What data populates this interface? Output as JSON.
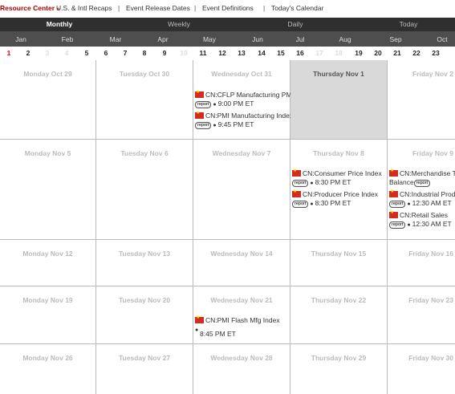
{
  "topnav": {
    "resource_center": "Resource Center",
    "resource_arrow": "»",
    "recaps": "U.S. & Intl Recaps",
    "release_dates": "Event Release Dates",
    "definitions": "Event Definitions",
    "todays": "Today's Calendar",
    "separator": "|"
  },
  "views": [
    "Monthly",
    "Weekly",
    "Daily",
    "Today"
  ],
  "months": [
    "Jan",
    "Feb",
    "Mar",
    "Apr",
    "May",
    "Jun",
    "Jul",
    "Aug",
    "Sep",
    "Oct"
  ],
  "day_numbers": [
    "1",
    "2",
    "3",
    "4",
    "5",
    "6",
    "7",
    "8",
    "9",
    "10",
    "11",
    "12",
    "13",
    "14",
    "15",
    "16",
    "17",
    "18",
    "19",
    "20",
    "21",
    "22",
    "23"
  ],
  "report_label": "report",
  "rows": [
    [
      "Monday Oct 29",
      "Tuesday Oct 30",
      "Wednesday Oct 31",
      "Thursday Nov 1",
      "Friday Nov 2"
    ],
    [
      "Monday Nov 5",
      "Tuesday Nov 6",
      "Wednesday Nov 7",
      "Thursday Nov 8",
      "Friday Nov 9"
    ],
    [
      "Monday Nov 12",
      "Tuesday Nov 13",
      "Wednesday Nov 14",
      "Thursday Nov 15",
      "Friday Nov 16"
    ],
    [
      "Monday Nov 19",
      "Tuesday Nov 20",
      "Wednesday Nov 21",
      "Thursday Nov 22",
      "Friday Nov 23"
    ],
    [
      "Monday Nov 26",
      "Tuesday Nov 27",
      "Wednesday Nov 28",
      "Thursday Nov 29",
      "Friday Nov 30"
    ]
  ],
  "events": {
    "oct31_a": {
      "name": "CN:CFLP Manufacturing PMI",
      "time": "9:00 PM ET"
    },
    "oct31_b": {
      "name": "CN:PMI Manufacturing Index",
      "time": "9:45 PM ET"
    },
    "nov8_a": {
      "name": "CN:Consumer Price Index",
      "time": "8:30 PM ET"
    },
    "nov8_b": {
      "name": "CN:Producer Price Index",
      "time": "8:30 PM ET"
    },
    "nov9_a": {
      "name": "CN:Merchandise Tr",
      "name2": "Balance"
    },
    "nov9_b": {
      "name": "CN:Industrial Produ",
      "time": "12:30 AM ET"
    },
    "nov9_c": {
      "name": "CN:Retail Sales",
      "time": "12:30 AM ET"
    },
    "nov21_a": {
      "name": "CN:PMI Flash Mfg Index",
      "time": "8:45 PM ET"
    }
  },
  "colors": {
    "accent": "#a00000",
    "today_number": "#dd0000",
    "highlight_cell": "#d9d9d9",
    "flag": "#d52b1e"
  }
}
